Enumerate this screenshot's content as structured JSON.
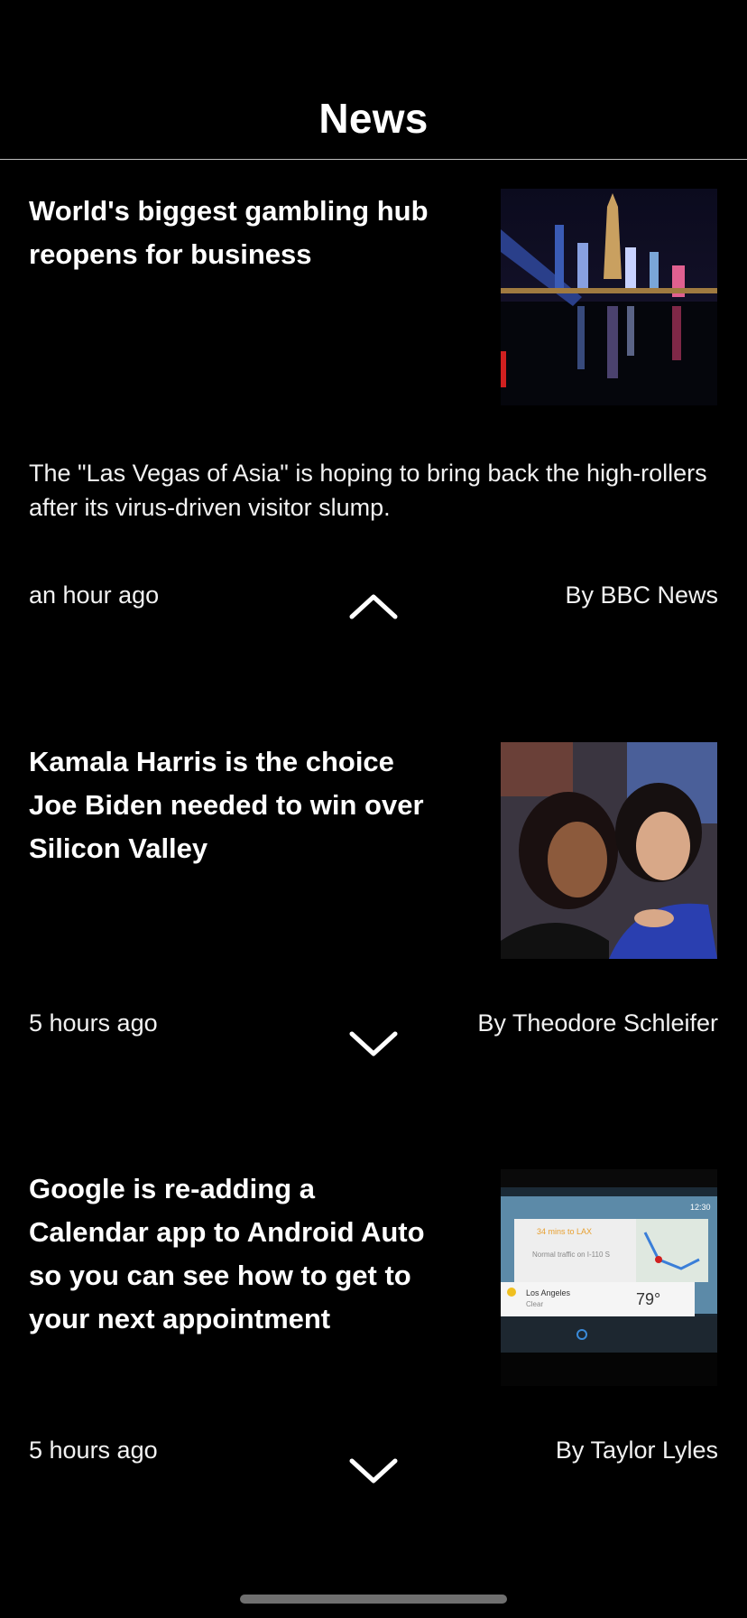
{
  "header": {
    "title": "News"
  },
  "articles": [
    {
      "headline": "World's biggest gambling hub reopens for business",
      "summary": "The \"Las Vegas of Asia\" is hoping to bring back the high-rollers after its virus-driven visitor slump.",
      "time": "an hour ago",
      "author": "By BBC News",
      "expanded": true
    },
    {
      "headline": "Kamala Harris is the choice Joe Biden needed to win over Silicon Valley",
      "time": "5 hours ago",
      "author": "By Theodore Schleifer",
      "expanded": false
    },
    {
      "headline": "Google is re-adding a Calendar app to Android Auto so you can see how to get to your next appointment",
      "time": "5 hours ago",
      "author": "By Taylor Lyles",
      "expanded": false,
      "thumb_text": {
        "clock": "12:30",
        "eta": "34 mins to LAX",
        "traffic": "Normal traffic on I-110 S",
        "city": "Los Angeles",
        "weather": "Clear",
        "temp": "79°"
      }
    }
  ]
}
